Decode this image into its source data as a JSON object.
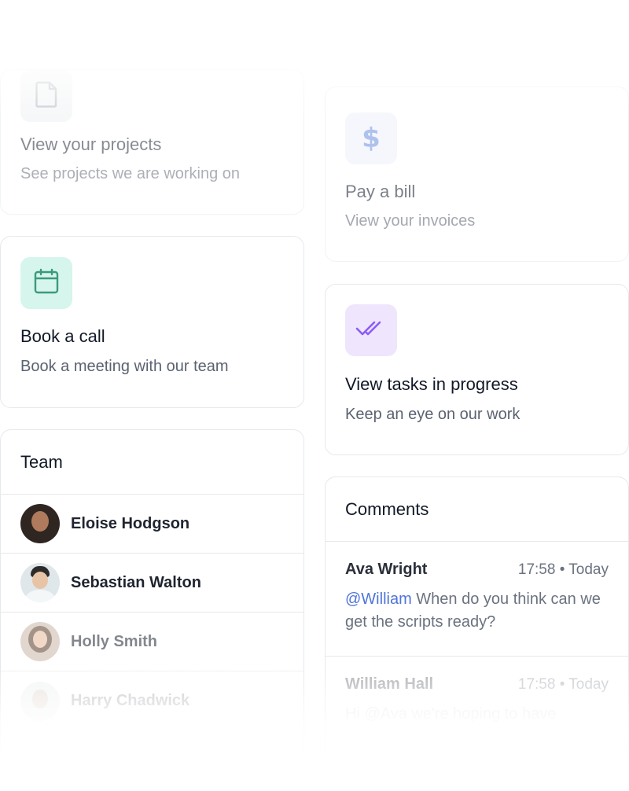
{
  "cards": {
    "projects": {
      "title": "View your projects",
      "subtitle": "See projects we are working on",
      "icon": "document-icon",
      "icon_bg": "#eef0f3"
    },
    "bill": {
      "title": "Pay a bill",
      "subtitle": "View your invoices",
      "icon": "dollar-icon",
      "icon_bg": "#eef2fb"
    },
    "call": {
      "title": "Book a call",
      "subtitle": "Book a meeting with our team",
      "icon": "calendar-icon",
      "icon_bg": "#d6f5ec"
    },
    "tasks": {
      "title": "View tasks in progress",
      "subtitle": "Keep an eye on our work",
      "icon": "double-check-icon",
      "icon_bg": "#efe5fd"
    }
  },
  "team": {
    "title": "Team",
    "members": [
      {
        "name": "Eloise Hodgson"
      },
      {
        "name": "Sebastian Walton"
      },
      {
        "name": "Holly Smith"
      },
      {
        "name": "Harry Chadwick"
      }
    ]
  },
  "comments": {
    "title": "Comments",
    "items": [
      {
        "author": "Ava Wright",
        "time": "17:58 • Today",
        "mention": "@William",
        "text": " When do you think can we get the scripts ready?"
      },
      {
        "author": "William Hall",
        "time": "17:58 • Today",
        "mention": "",
        "text": "Hi @Ava we're hoping to have"
      }
    ]
  },
  "colors": {
    "mention": "#4f74d9",
    "calendar_icon": "#3a9a7c",
    "dollar_icon": "#8aa4e8",
    "check_icon": "#8b5cf6"
  }
}
